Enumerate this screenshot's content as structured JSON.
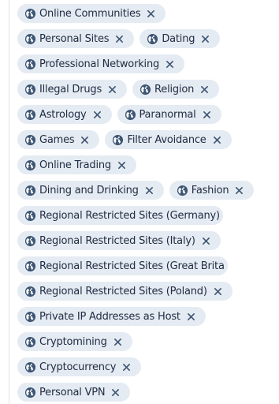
{
  "colors": {
    "chip_background": "#e5ebf2",
    "chip_text": "#202d44",
    "icon": "#3d5573",
    "divider": "#dde3ea"
  },
  "tag_rows": [
    [
      {
        "label": "Online Communities",
        "icon": "globe-icon",
        "remove_icon": "close-icon"
      }
    ],
    [
      {
        "label": "Personal Sites",
        "icon": "globe-icon",
        "remove_icon": "close-icon"
      },
      {
        "label": "Dating",
        "icon": "globe-icon",
        "remove_icon": "close-icon"
      }
    ],
    [
      {
        "label": "Professional Networking",
        "icon": "globe-icon",
        "remove_icon": "close-icon"
      }
    ],
    [
      {
        "label": "Illegal Drugs",
        "icon": "globe-icon",
        "remove_icon": "close-icon"
      },
      {
        "label": "Religion",
        "icon": "globe-icon",
        "remove_icon": "close-icon"
      }
    ],
    [
      {
        "label": "Astrology",
        "icon": "globe-icon",
        "remove_icon": "close-icon"
      },
      {
        "label": "Paranormal",
        "icon": "globe-icon",
        "remove_icon": "close-icon"
      }
    ],
    [
      {
        "label": "Games",
        "icon": "globe-icon",
        "remove_icon": "close-icon"
      },
      {
        "label": "Filter Avoidance",
        "icon": "globe-icon",
        "remove_icon": "close-icon"
      }
    ],
    [
      {
        "label": "Online Trading",
        "icon": "globe-icon",
        "remove_icon": "close-icon"
      }
    ],
    [
      {
        "label": "Dining and Drinking",
        "icon": "globe-icon",
        "remove_icon": "close-icon"
      },
      {
        "label": "Fashion",
        "icon": "globe-icon",
        "remove_icon": "close-icon"
      }
    ],
    [
      {
        "label": "Regional Restricted Sites (Germany)",
        "icon": "globe-icon",
        "remove_icon": ""
      }
    ],
    [
      {
        "label": "Regional Restricted Sites (Italy)",
        "icon": "globe-icon",
        "remove_icon": "close-icon"
      }
    ],
    [
      {
        "label": "Regional Restricted Sites (Great Brita",
        "icon": "globe-icon",
        "remove_icon": ""
      }
    ],
    [
      {
        "label": "Regional Restricted Sites (Poland)",
        "icon": "globe-icon",
        "remove_icon": "close-icon"
      }
    ],
    [
      {
        "label": "Private IP Addresses as Host",
        "icon": "globe-icon",
        "remove_icon": "close-icon"
      }
    ],
    [
      {
        "label": "Cryptomining",
        "icon": "globe-icon",
        "remove_icon": "close-icon"
      }
    ],
    [
      {
        "label": "Cryptocurrency",
        "icon": "globe-icon",
        "remove_icon": "close-icon"
      }
    ],
    [
      {
        "label": "Personal VPN",
        "icon": "globe-icon",
        "remove_icon": "close-icon"
      }
    ]
  ]
}
